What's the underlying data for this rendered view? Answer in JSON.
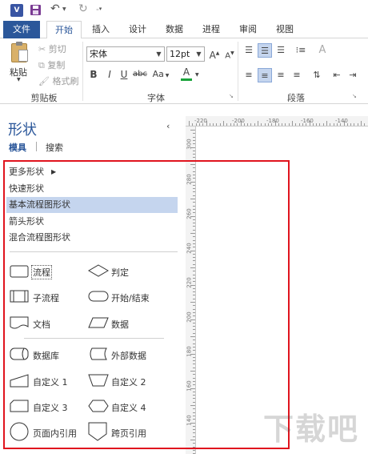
{
  "quick_access": {
    "app_icon": "visio-logo",
    "save_icon": "save-icon",
    "undo_icon": "undo-icon",
    "redo_icon": "redo-icon",
    "customize_icon": "customize-qat-icon"
  },
  "tabs": [
    "文件",
    "开始",
    "插入",
    "设计",
    "数据",
    "进程",
    "审阅",
    "视图"
  ],
  "active_tab": "开始",
  "ribbon": {
    "clipboard": {
      "paste": "粘贴",
      "cut": "剪切",
      "copy": "复制",
      "format_painter": "格式刷",
      "group_label": "剪贴板"
    },
    "font": {
      "font_name": "宋体",
      "font_size": "12pt",
      "grow": "A",
      "shrink": "A",
      "bold": "B",
      "italic": "I",
      "underline": "U",
      "strike": "abc",
      "case": "Aa",
      "color": "A",
      "group_label": "字体"
    },
    "paragraph": {
      "group_label": "段落"
    }
  },
  "shapes_panel": {
    "title": "形状",
    "tab_stencils": "模具",
    "tab_search": "搜索",
    "menu": [
      {
        "label": "更多形状",
        "selected": false
      },
      {
        "label": "快速形状",
        "selected": false
      },
      {
        "label": "基本流程图形状",
        "selected": true
      },
      {
        "label": "箭头形状",
        "selected": false
      },
      {
        "label": "混合流程图形状",
        "selected": false
      }
    ],
    "stencils": [
      {
        "label": "流程",
        "icon": "process-shape-icon"
      },
      {
        "label": "判定",
        "icon": "decision-shape-icon"
      },
      {
        "label": "子流程",
        "icon": "subprocess-shape-icon"
      },
      {
        "label": "开始/结束",
        "icon": "start-end-shape-icon"
      },
      {
        "label": "文档",
        "icon": "document-shape-icon"
      },
      {
        "label": "数据",
        "icon": "data-shape-icon"
      },
      {
        "label": "数据库",
        "icon": "database-shape-icon"
      },
      {
        "label": "外部数据",
        "icon": "external-data-shape-icon"
      },
      {
        "label": "自定义 1",
        "icon": "custom1-shape-icon"
      },
      {
        "label": "自定义 2",
        "icon": "custom2-shape-icon"
      },
      {
        "label": "自定义 3",
        "icon": "custom3-shape-icon"
      },
      {
        "label": "自定义 4",
        "icon": "custom4-shape-icon"
      },
      {
        "label": "页面内引用",
        "icon": "on-page-reference-shape-icon"
      },
      {
        "label": "跨页引用",
        "icon": "off-page-reference-shape-icon"
      }
    ]
  },
  "ruler": {
    "top": [
      "-220",
      "-200",
      "-180",
      "-160",
      "-140"
    ],
    "left": [
      "300",
      "280",
      "260",
      "240",
      "220",
      "200",
      "180",
      "160",
      "140"
    ]
  },
  "colors": {
    "file_tab": "#2b579a",
    "selection": "#c5d5ee",
    "highlight_border": "#e0141e",
    "visio_blue": "#3955a3",
    "font_color": "#1aa33a"
  },
  "watermark": "下载吧"
}
